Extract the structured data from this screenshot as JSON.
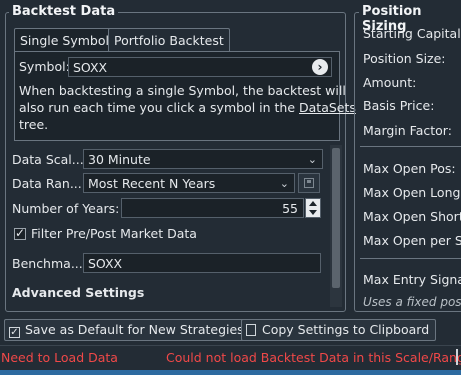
{
  "backtest": {
    "title": "Backtest Data",
    "tabs": [
      "Single Symbol",
      "Portfolio Backtest"
    ],
    "symbol_label": "Symbol:",
    "symbol_value": "SOXX",
    "info_text_1": "When backtesting a single Symbol, the backtest will",
    "info_text_2": "also run each time you click a symbol in the ",
    "info_link": "DataSets",
    "info_text_3": "tree.",
    "data_scale_label": "Data Scal...",
    "data_scale_value": "30 Minute",
    "data_range_label": "Data Ran...",
    "data_range_value": "Most Recent N Years",
    "num_years_label": "Number of Years:",
    "num_years_value": "55",
    "filter_label": "Filter Pre/Post Market Data",
    "benchmark_label": "Benchma...",
    "benchmark_value": "SOXX",
    "advanced_label": "Advanced Settings"
  },
  "position": {
    "title": "Position Sizing",
    "items": [
      "Starting Capital:",
      "Position Size:",
      "Amount:",
      "Basis Price:",
      "Margin Factor:",
      "Max Open Pos:",
      "Max Open Long:",
      "Max Open Short:",
      "Max Open per Sy",
      "Max Entry Signal",
      "Uses a fixed positi"
    ]
  },
  "footer": {
    "save_default_label": "Save as Default for New Strategies",
    "copy_settings_label": "Copy Settings to Clipboard"
  },
  "status": {
    "left": "Need to Load Data",
    "right": "Could not load Backtest Data in this Scale/Range."
  },
  "colors": {
    "background": "#232c35",
    "error_text": "#f04848"
  }
}
